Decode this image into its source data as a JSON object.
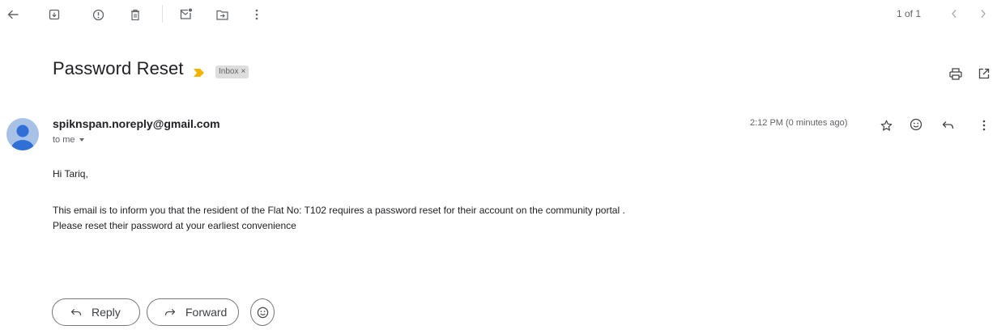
{
  "toolbar": {
    "icons": [
      "back-arrow-icon",
      "archive-icon",
      "report-spam-icon",
      "delete-icon",
      "mark-unread-icon",
      "move-to-icon",
      "more-vert-icon"
    ]
  },
  "pager": {
    "text": "1 of 1",
    "icons": [
      "chevron-left-icon",
      "chevron-right-icon"
    ]
  },
  "message": {
    "subject": "Password Reset",
    "label": "Inbox",
    "label_close": "×",
    "importance_color": "#f2b400",
    "sender_email": "spiknspan.noreply@gmail.com",
    "recipient_text": "to me",
    "time": "2:12 PM (0 minutes ago)",
    "header_icons": [
      "print-icon",
      "open-in-new-window-icon"
    ],
    "action_icons": [
      "star-icon",
      "emoji-react-icon",
      "reply-icon",
      "more-vert-icon"
    ],
    "greeting": "Hi Tariq,",
    "body_line1": "This email is to inform you that the resident of the Flat No: T102 requires a password reset for their account on the community portal .",
    "body_line2": "Please reset their password at your earliest convenience"
  },
  "actions": {
    "reply_label": "Reply",
    "forward_label": "Forward",
    "emoji_icon": "emoji-react-icon"
  }
}
